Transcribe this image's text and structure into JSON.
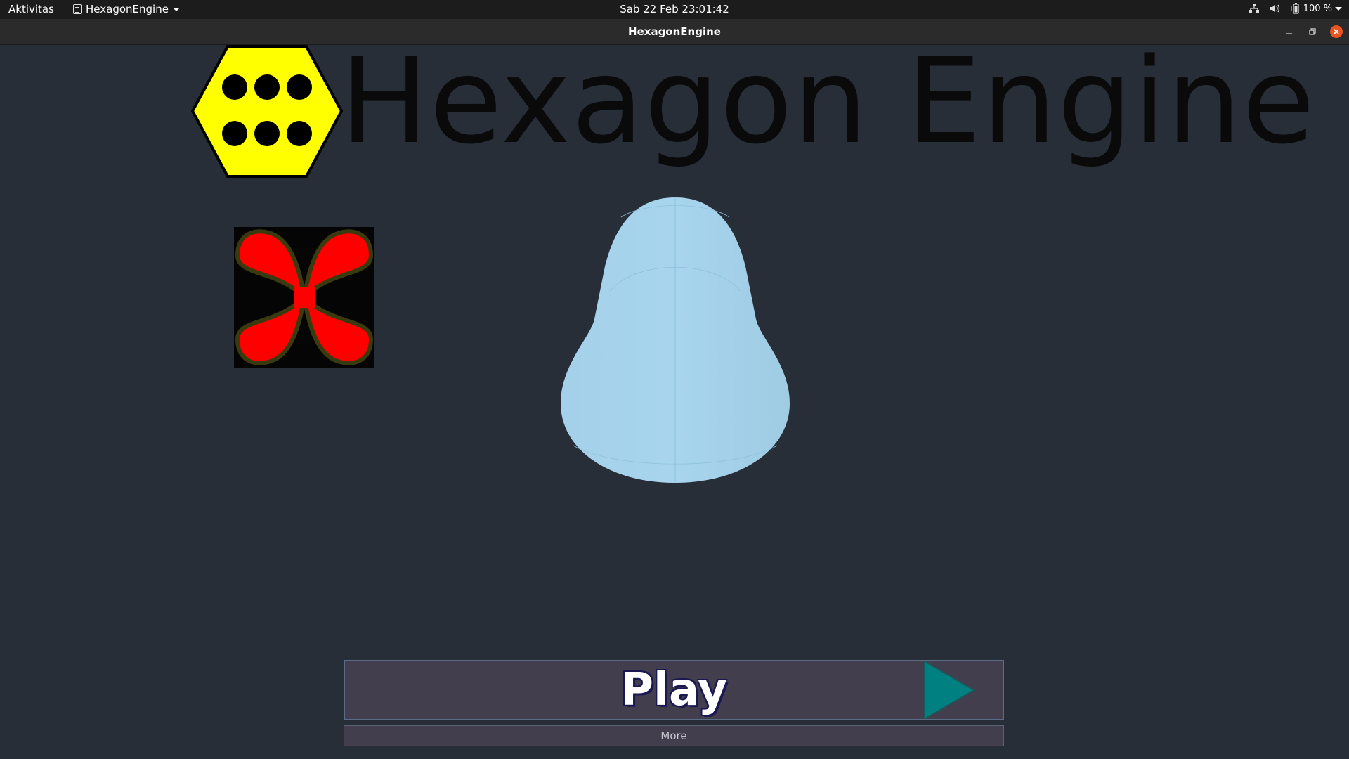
{
  "topbar": {
    "activities": "Aktivitas",
    "app_name": "HexagonEngine",
    "clock": "Sab 22 Feb  23:01:42",
    "battery": "100 %",
    "icons": [
      "network-icon",
      "volume-icon",
      "battery-icon",
      "system-menu-icon"
    ]
  },
  "window": {
    "title": "HexagonEngine",
    "controls": [
      "minimize-icon",
      "maximize-icon",
      "close-icon"
    ],
    "close_color": "#e95420"
  },
  "game": {
    "title": "Hexagon Engine",
    "logo": {
      "hex_color": "#ffff00",
      "dot_color": "#000000"
    },
    "flower_colors": {
      "petal": "#ff0000",
      "outline": "#3a3a10",
      "background": "#050505"
    },
    "capsule_color": "#a6d3ec",
    "play_label": "Play",
    "play_icon_color": "#008080",
    "more_label": "More"
  }
}
